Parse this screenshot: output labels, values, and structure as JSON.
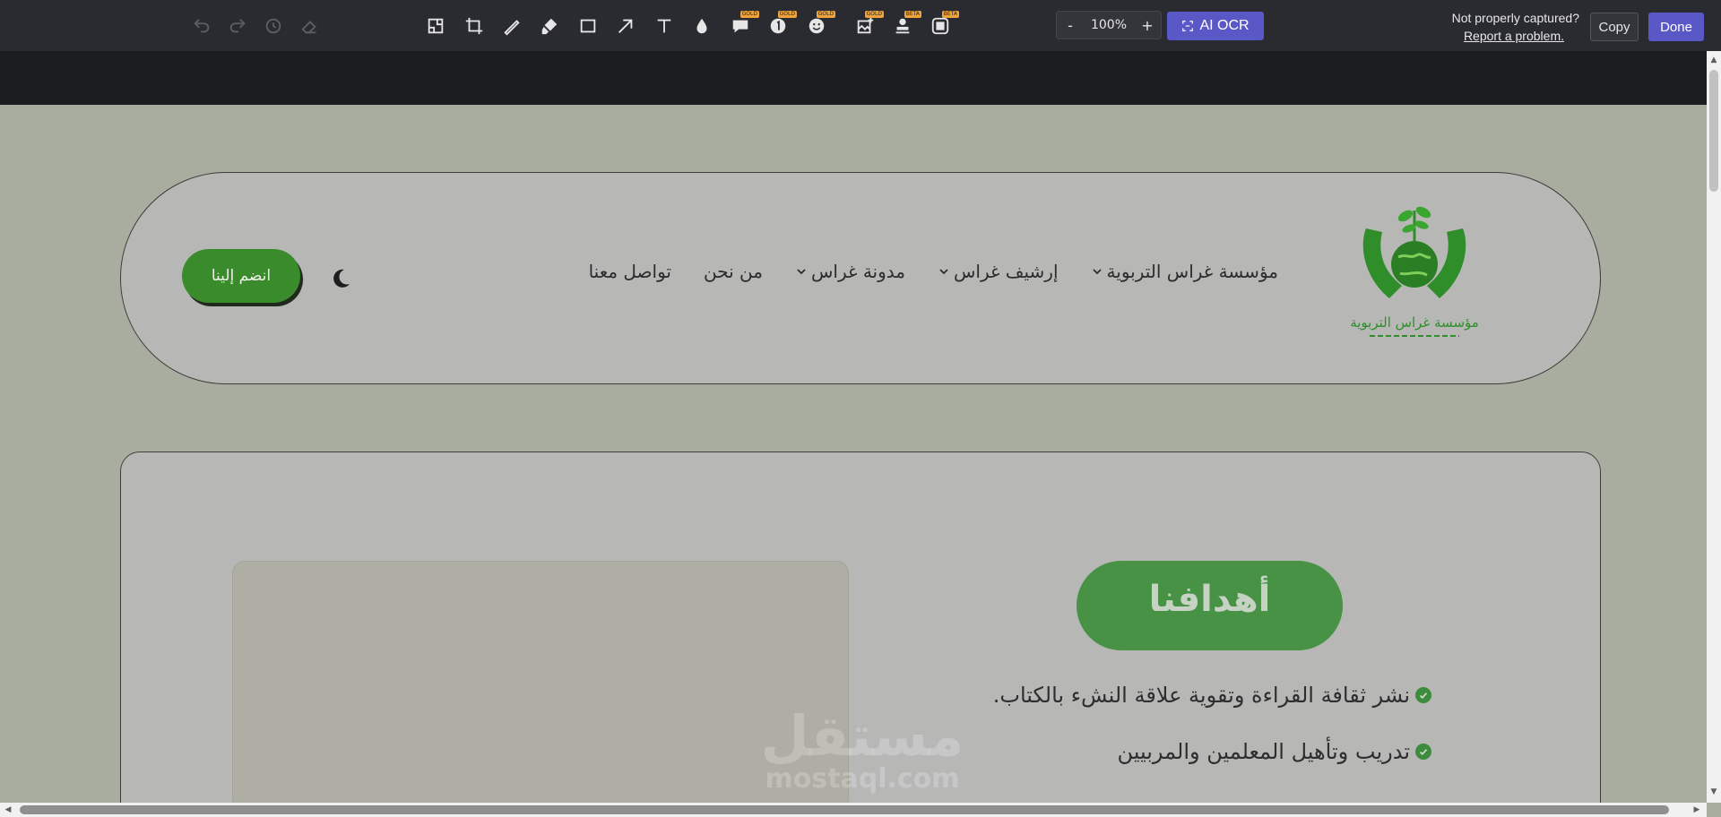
{
  "toolbar": {
    "tools": [
      {
        "name": "undo-icon",
        "disabled": true
      },
      {
        "name": "redo-icon",
        "disabled": true
      },
      {
        "name": "reset-icon",
        "disabled": true
      },
      {
        "name": "eraser-icon",
        "disabled": true
      },
      {
        "name": "resize-icon"
      },
      {
        "name": "crop-icon"
      },
      {
        "name": "pen-icon"
      },
      {
        "name": "highlighter-icon"
      },
      {
        "name": "rectangle-icon"
      },
      {
        "name": "arrow-icon"
      },
      {
        "name": "text-icon"
      },
      {
        "name": "blur-drop-icon"
      },
      {
        "name": "callout-icon",
        "badge": "GOLD"
      },
      {
        "name": "step-number-icon",
        "badge": "GOLD"
      },
      {
        "name": "emoji-icon",
        "badge": "GOLD"
      },
      {
        "name": "image-insert-icon",
        "badge": "GOLD"
      },
      {
        "name": "stamp-icon",
        "badge": "BETA"
      },
      {
        "name": "frame-icon",
        "badge": "BETA"
      }
    ],
    "zoom": {
      "minus": "-",
      "value": "100%",
      "plus": "+"
    },
    "ai_ocr_label": "AI OCR",
    "not_captured": "Not properly captured?",
    "report_link": "Report a problem.",
    "copy_label": "Copy",
    "done_label": "Done",
    "accent_color": "#5a57c7"
  },
  "site": {
    "logo_text": "مؤسسة غراس التربوية",
    "nav": [
      {
        "label": "مؤسسة غراس التربوية",
        "dropdown": true
      },
      {
        "label": "إرشيف غراس",
        "dropdown": true
      },
      {
        "label": "مدونة غراس",
        "dropdown": true
      },
      {
        "label": "من نحن",
        "dropdown": false
      },
      {
        "label": "تواصل معنا",
        "dropdown": false
      }
    ],
    "join_label": "انضم إلينا",
    "goals_title": "أهدافنا",
    "goals": [
      "نشر ثقافة القراءة وتقوية علاقة النشء بالكتاب.",
      "تدريب وتأهيل المعلمين والمربيين"
    ],
    "watermark_ar": "مستقل",
    "watermark_en": "mostaql.com",
    "brand_green": "#3a8b2b"
  }
}
